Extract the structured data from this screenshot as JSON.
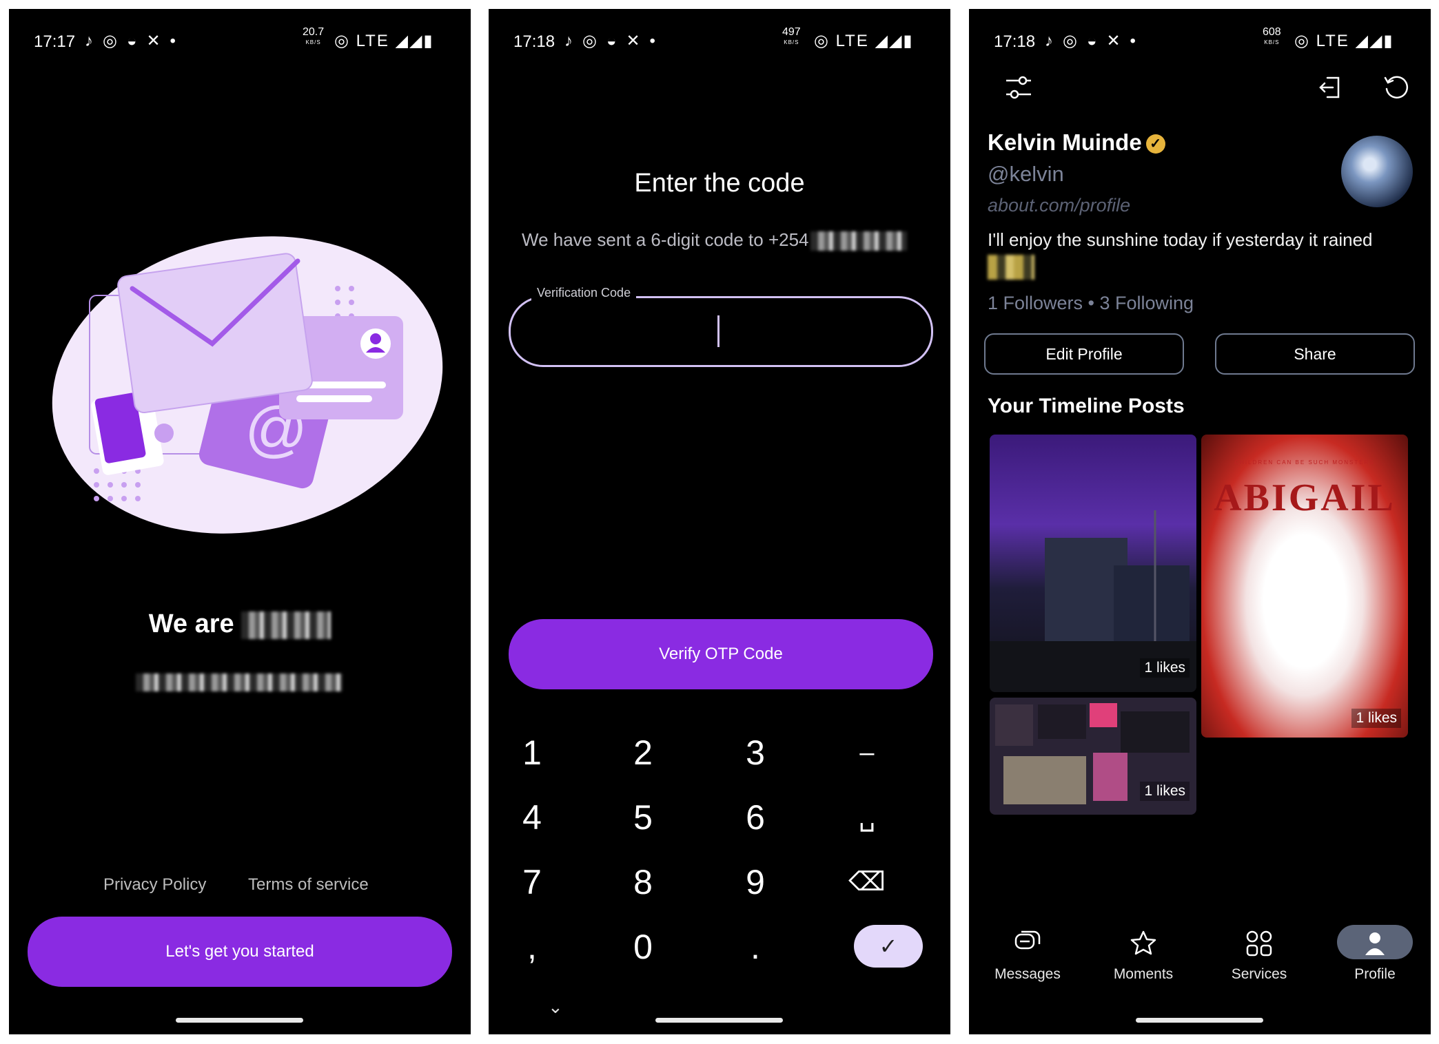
{
  "screen1": {
    "status": {
      "time": "17:17",
      "speed": "20.7",
      "speed_unit": "KB/S",
      "network": "LTE"
    },
    "welcome_prefix": "We are",
    "privacy_policy": "Privacy Policy",
    "terms": "Terms of service",
    "cta": "Let's get you started"
  },
  "screen2": {
    "status": {
      "time": "17:18",
      "speed": "497",
      "speed_unit": "KB/S",
      "network": "LTE"
    },
    "title": "Enter the code",
    "sent_text": "We have sent a 6-digit code to +254",
    "field_label": "Verification Code",
    "verify_button": "Verify OTP Code",
    "keys": [
      "1",
      "2",
      "3",
      "–",
      "4",
      "5",
      "6",
      "␣",
      "7",
      "8",
      "9",
      "⌫",
      ",",
      "0",
      ".",
      "✓"
    ],
    "collapse_icon": "⌄"
  },
  "screen3": {
    "status": {
      "time": "17:18",
      "speed": "608",
      "speed_unit": "KB/S",
      "network": "LTE"
    },
    "name": "Kelvin Muinde",
    "handle": "@kelvin",
    "link": "about.com/profile",
    "bio": "I'll enjoy the sunshine today if yesterday it rained",
    "followers": "1 Followers • 3 Following",
    "edit_profile": "Edit Profile",
    "share": "Share",
    "timeline_title": "Your Timeline Posts",
    "posts": [
      {
        "likes": "1 likes"
      },
      {
        "likes": "1 likes",
        "poster_top": "CHILDREN CAN BE SUCH MONSTERS",
        "poster_title": "ABIGAIL"
      },
      {
        "likes": "1 likes"
      }
    ],
    "nav": [
      {
        "label": "Messages",
        "icon": "messages-icon"
      },
      {
        "label": "Moments",
        "icon": "star-icon"
      },
      {
        "label": "Services",
        "icon": "grid-icon"
      },
      {
        "label": "Profile",
        "icon": "person-icon",
        "active": true
      }
    ]
  },
  "colors": {
    "accent": "#8a2be2",
    "accent_light": "#e3d8fa",
    "verified": "#e7b43c"
  }
}
